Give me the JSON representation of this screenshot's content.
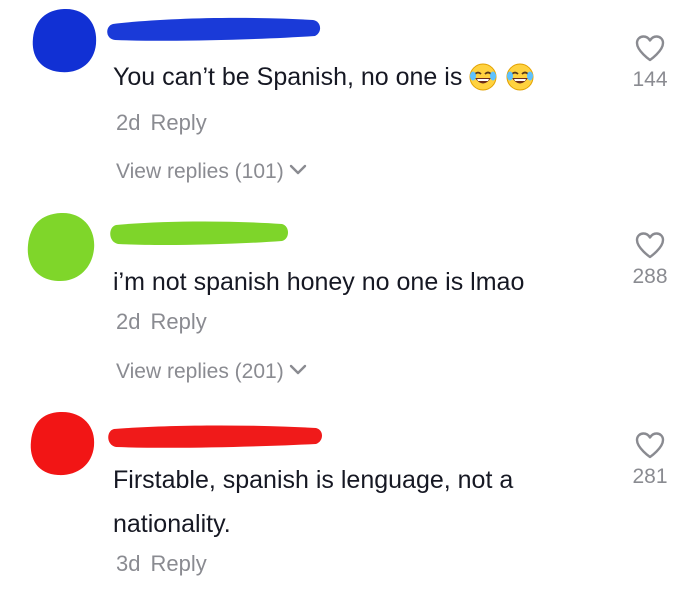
{
  "comments": [
    {
      "avatar_color": "#1130d4",
      "name_color": "#1a3ad8",
      "text": "You can’t be Spanish, no one is",
      "emojis": [
        "face-with-tears-of-joy",
        "face-with-tears-of-joy"
      ],
      "time": "2d",
      "reply_label": "Reply",
      "view_replies": "View replies (101)",
      "likes": "144"
    },
    {
      "avatar_color": "#7fd62a",
      "name_color": "#7ed52a",
      "text": "i’m not spanish honey no one is lmao",
      "time": "2d",
      "reply_label": "Reply",
      "view_replies": "View replies (201)",
      "likes": "288"
    },
    {
      "avatar_color": "#f21515",
      "name_color": "#f01a1a",
      "text_line1": "Firstable, spanish is lenguage, not a",
      "text_line2": "nationality.",
      "time": "3d",
      "reply_label": "Reply",
      "likes": "281"
    }
  ]
}
